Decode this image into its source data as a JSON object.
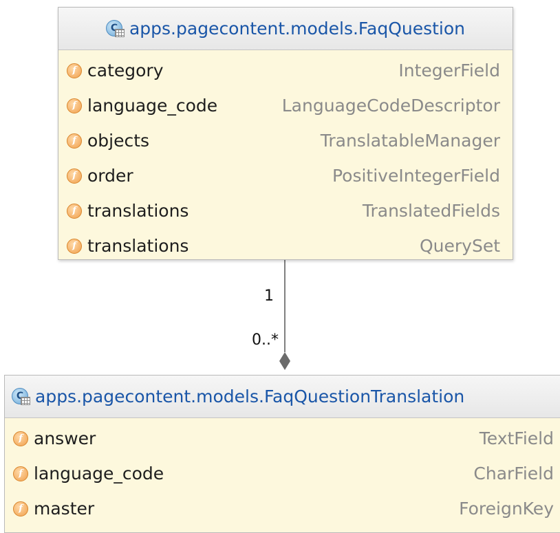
{
  "classes": [
    {
      "name": "apps.pagecontent.models.FaqQuestion",
      "icon": "class-table-icon",
      "fields": [
        {
          "name": "category",
          "type": "IntegerField"
        },
        {
          "name": "language_code",
          "type": "LanguageCodeDescriptor"
        },
        {
          "name": "objects",
          "type": "TranslatableManager"
        },
        {
          "name": "order",
          "type": "PositiveIntegerField"
        },
        {
          "name": "translations",
          "type": "TranslatedFields"
        },
        {
          "name": "translations",
          "type": "QuerySet"
        }
      ]
    },
    {
      "name": "apps.pagecontent.models.FaqQuestionTranslation",
      "icon": "class-table-icon",
      "fields": [
        {
          "name": "answer",
          "type": "TextField"
        },
        {
          "name": "language_code",
          "type": "CharField"
        },
        {
          "name": "master",
          "type": "ForeignKey"
        }
      ]
    }
  ],
  "relation": {
    "source_multiplicity": "1",
    "target_multiplicity": "0..*"
  },
  "icons": {
    "class_badge": "C",
    "field_badge": "f"
  },
  "colors": {
    "class_name": "#1a56a8",
    "body": "#fdf8dd",
    "field_type": "#8a8a8a"
  }
}
